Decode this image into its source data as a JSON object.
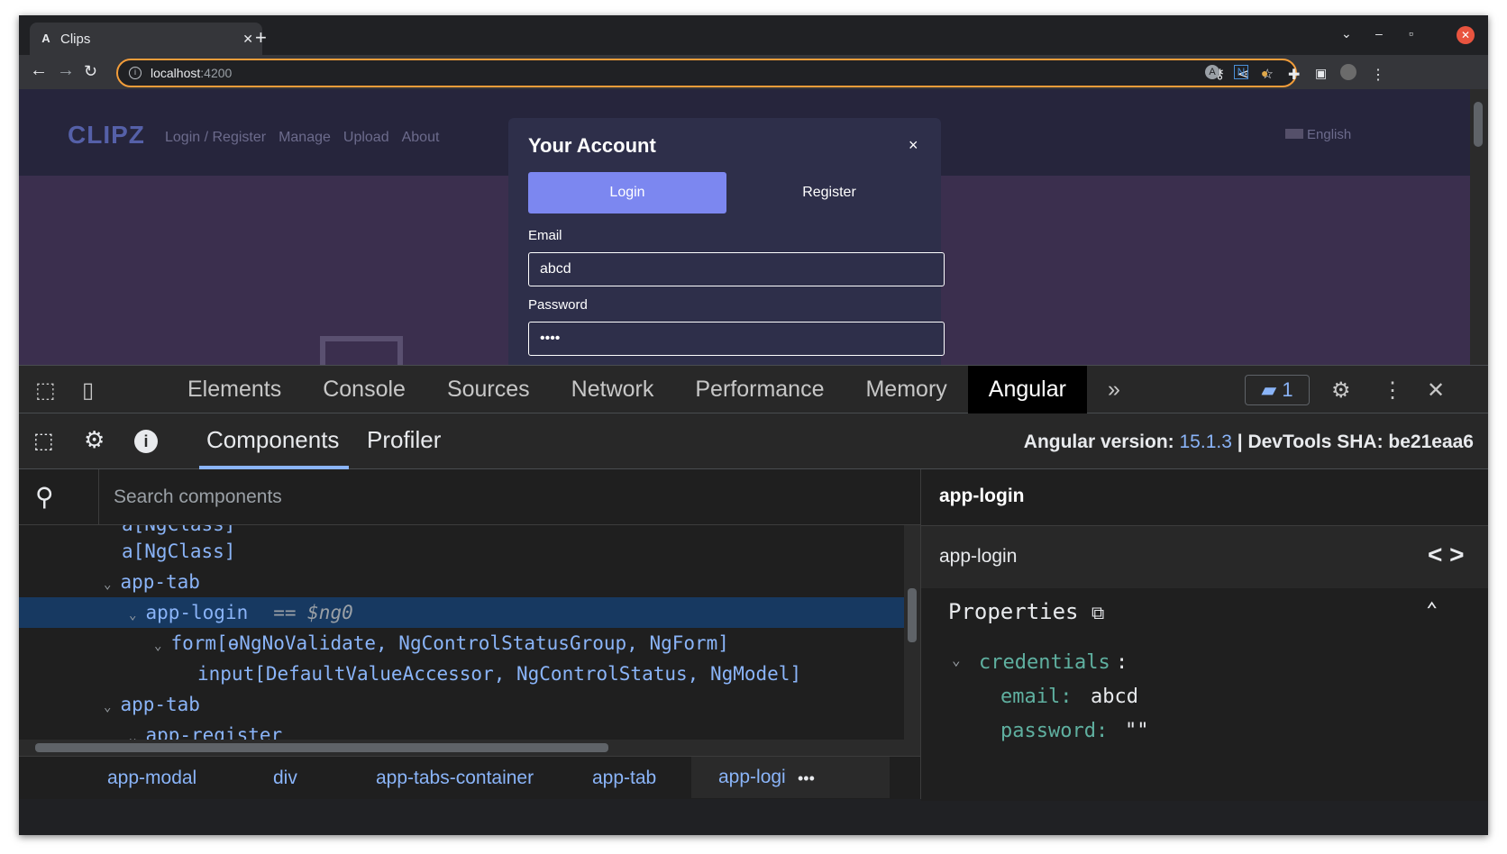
{
  "browser": {
    "tab_title": "Clips",
    "tab_favicon": "A",
    "url_host": "localhost",
    "url_port": ":4200"
  },
  "page": {
    "logo": "CLIPZ",
    "nav": [
      "Login / Register",
      "Manage",
      "Upload",
      "About"
    ],
    "language": "English"
  },
  "modal": {
    "title": "Your Account",
    "close": "×",
    "login_tab": "Login",
    "register_tab": "Register",
    "email_label": "Email",
    "email_value": "abcd",
    "password_label": "Password",
    "password_value": "••••"
  },
  "devtools": {
    "tabs": [
      "Elements",
      "Console",
      "Sources",
      "Network",
      "Performance",
      "Memory",
      "Angular"
    ],
    "active_tab": "Angular",
    "more": "»",
    "issues_count": "1",
    "close": "✕",
    "subtabs": [
      "Components",
      "Profiler"
    ],
    "version_label": "Angular version:",
    "version_number": "15.1.3",
    "sha_label": "| DevTools SHA: be21eaa6",
    "search_placeholder": "Search components",
    "tree": [
      {
        "text": "a[NgClass]",
        "ng": ""
      },
      {
        "text": "a[NgClass]",
        "ng": ""
      },
      {
        "text": "app-tab",
        "ng": ""
      },
      {
        "text": "app-login",
        "ng": "== $ng0"
      },
      {
        "text": "form[ɵNgNoValidate, NgControlStatusGroup, NgForm]",
        "ng": ""
      },
      {
        "text": "input[DefaultValueAccessor, NgControlStatus, NgModel]",
        "ng": ""
      },
      {
        "text": "app-tab",
        "ng": ""
      },
      {
        "text": "app-register",
        "ng": ""
      }
    ],
    "breadcrumbs": [
      "app-modal",
      "div",
      "app-tabs-container",
      "app-tab",
      "app-logi"
    ],
    "breadcrumb_more": "•••",
    "selected_title": "app-login",
    "component_name": "app-login",
    "code_icon": "< >",
    "properties_label": "Properties",
    "properties": {
      "object_key": "credentials",
      "colon": ":",
      "email_key": "email:",
      "email_value": "abcd",
      "password_key": "password:",
      "password_value": "\"\""
    }
  },
  "colors": {
    "accent": "#8ab4f8",
    "login_button": "#7c87f0",
    "omnibox_border": "#f29d3a",
    "selection": "#173961"
  }
}
